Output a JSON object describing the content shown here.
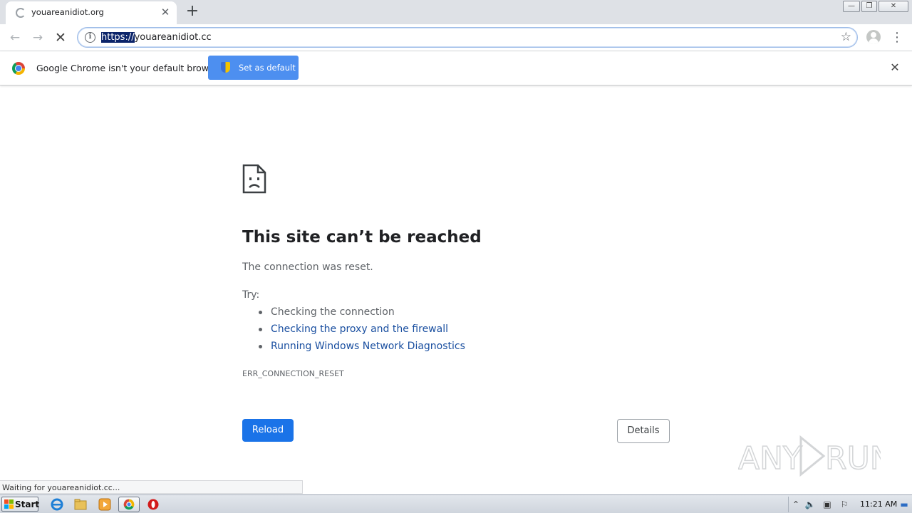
{
  "tab": {
    "title": "youareanidiot.org",
    "close": "✕"
  },
  "new_tab": "+",
  "window_controls": {
    "minimize": "—",
    "restore": "❐",
    "close": "✕"
  },
  "toolbar": {
    "back": "←",
    "forward": "→",
    "stop": "✕",
    "info_icon": "i",
    "url_selected": "https://",
    "url_rest": "youareanidiot.cc",
    "star": "☆",
    "menu": "⋮"
  },
  "infobar": {
    "message": "Google Chrome isn't your default browser",
    "button": "Set as default",
    "close": "✕"
  },
  "error": {
    "title": "This site can’t be reached",
    "subtitle": "The connection was reset.",
    "try_label": "Try:",
    "suggestions": [
      "Checking the connection",
      "Checking the proxy and the firewall",
      "Running Windows Network Diagnostics"
    ],
    "code": "ERR_CONNECTION_RESET",
    "reload": "Reload",
    "details": "Details"
  },
  "status_bar": "Waiting for youareanidiot.cc...",
  "watermark": "ANY RUN",
  "taskbar": {
    "start": "Start",
    "time": "11:21 AM"
  },
  "colors": {
    "accent": "#1a73e8",
    "link": "#1a4fa0",
    "infobar_button": "#4d8ff0"
  }
}
